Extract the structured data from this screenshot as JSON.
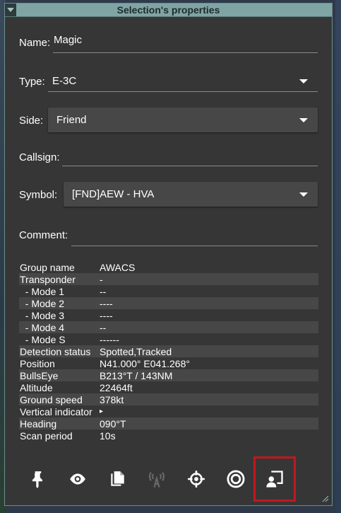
{
  "window": {
    "title": "Selection's properties"
  },
  "form": {
    "name": {
      "label": "Name:",
      "value": "Magic"
    },
    "type": {
      "label": "Type:",
      "value": "E-3C"
    },
    "side": {
      "label": "Side:",
      "value": "Friend"
    },
    "callsign": {
      "label": "Callsign:",
      "value": ""
    },
    "symbol": {
      "label": "Symbol:",
      "value": "[FND]AEW - HVA"
    },
    "comment": {
      "label": "Comment:",
      "value": ""
    }
  },
  "properties": [
    {
      "key": "Group name",
      "value": "AWACS"
    },
    {
      "key": "Transponder",
      "value": "-"
    },
    {
      "key": "  - Mode 1",
      "value": "--"
    },
    {
      "key": "  - Mode 2",
      "value": "----"
    },
    {
      "key": "  - Mode 3",
      "value": "----"
    },
    {
      "key": "  - Mode 4",
      "value": "--"
    },
    {
      "key": "  - Mode S",
      "value": "------"
    },
    {
      "key": "Detection status",
      "value": "Spotted,Tracked"
    },
    {
      "key": "Position",
      "value": "N41.000° E041.268°"
    },
    {
      "key": "BullsEye",
      "value": "B213°T / 143NM"
    },
    {
      "key": "Altitude",
      "value": "22464ft"
    },
    {
      "key": "Ground speed",
      "value": "378kt"
    },
    {
      "key": "Vertical indicator",
      "value": "▸"
    },
    {
      "key": "Heading",
      "value": "090°T"
    },
    {
      "key": "Scan period",
      "value": "10s"
    }
  ],
  "toolbar": {
    "buttons": [
      {
        "icon": "pin-icon"
      },
      {
        "icon": "eye-icon"
      },
      {
        "icon": "copy-icon"
      },
      {
        "icon": "antenna-icon",
        "disabled": true
      },
      {
        "icon": "crosshair-icon"
      },
      {
        "icon": "target-icon"
      },
      {
        "icon": "person-card-icon",
        "active": true
      }
    ]
  },
  "colors": {
    "panel": "#363636",
    "titlebar": "#7fa4a4",
    "row_alt": "#474747",
    "active_outline": "#c0181f"
  }
}
